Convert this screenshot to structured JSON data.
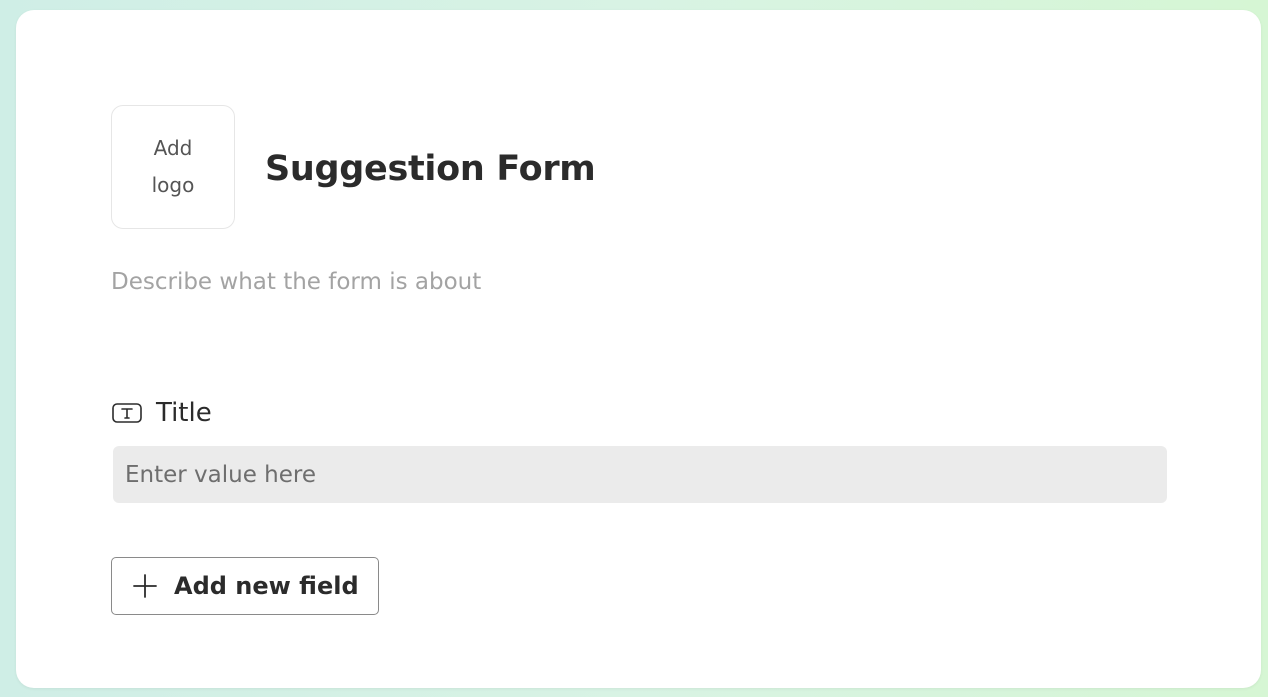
{
  "form": {
    "logo_placeholder": "Add logo",
    "title": "Suggestion Form",
    "description_placeholder": "Describe what the form is about"
  },
  "fields": [
    {
      "type_icon": "text-type-icon",
      "label": "Title",
      "input_placeholder": "Enter value here",
      "input_value": ""
    }
  ],
  "actions": {
    "add_field_icon": "plus-icon",
    "add_field_label": "Add new field"
  },
  "colors": {
    "background_start": "#cfeee6",
    "background_end": "#d6f6d4",
    "card": "#ffffff",
    "input_fill": "#ebebeb",
    "primary_text": "#2b2b2b",
    "muted_text": "#a3a3a3"
  }
}
